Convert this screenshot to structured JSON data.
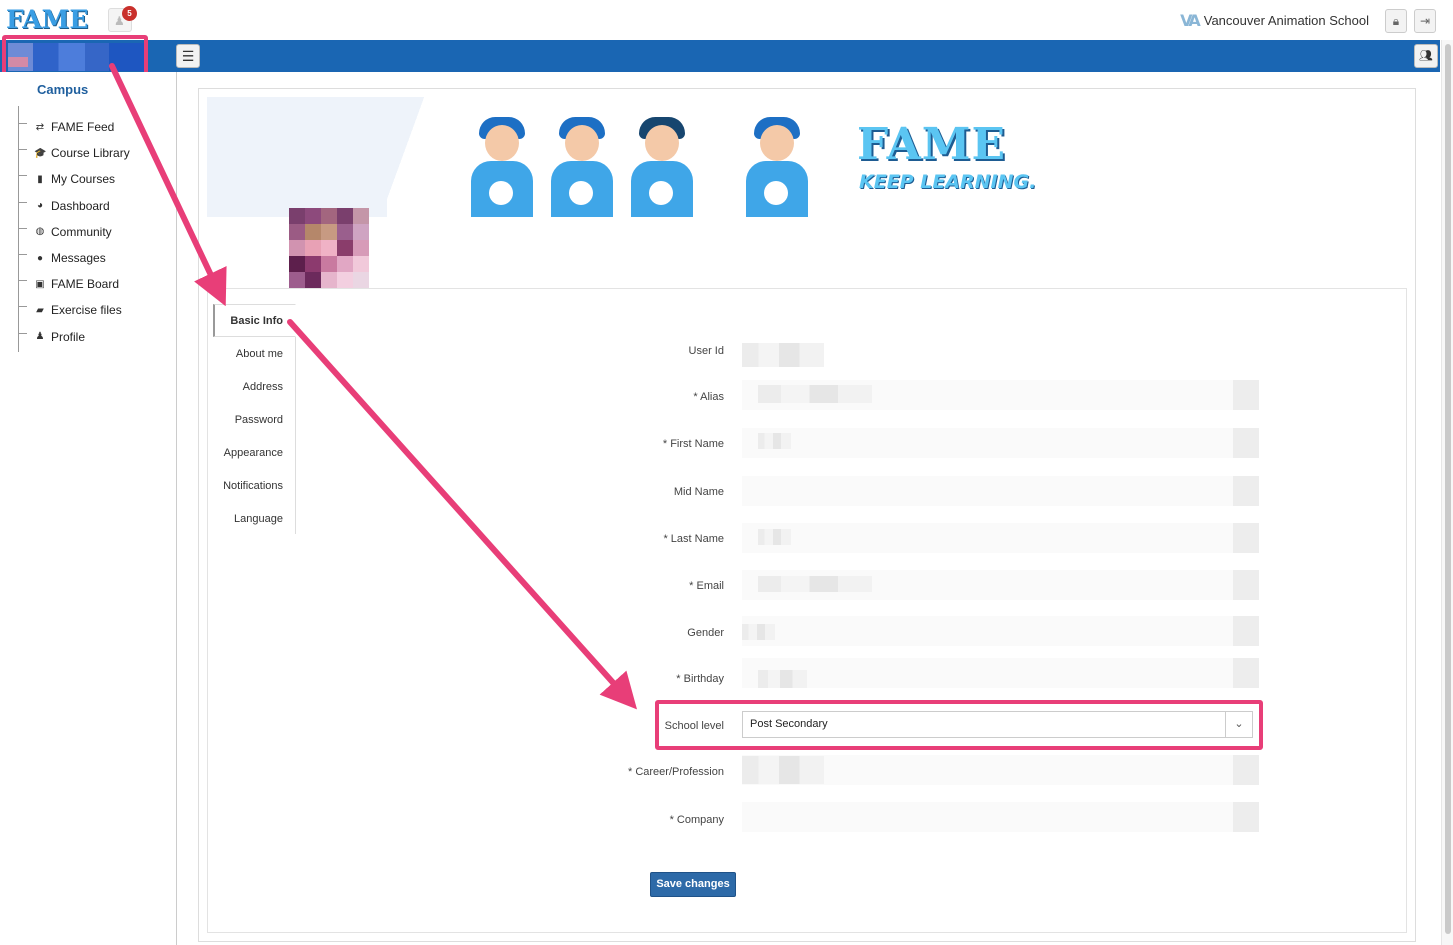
{
  "header": {
    "logo": "FAME",
    "notification_count": "5",
    "school_name": "Vancouver Animation School",
    "school_logo": "VA"
  },
  "sidebar": {
    "section_title": "Campus",
    "items": [
      {
        "label": "FAME Feed",
        "icon": "retweet-icon",
        "glyph": "⇄"
      },
      {
        "label": "Course Library",
        "icon": "graduation-cap-icon",
        "glyph": "🎓"
      },
      {
        "label": "My Courses",
        "icon": "book-icon",
        "glyph": "▮"
      },
      {
        "label": "Dashboard",
        "icon": "dashboard-icon",
        "glyph": "◕"
      },
      {
        "label": "Community",
        "icon": "globe-icon",
        "glyph": "◍"
      },
      {
        "label": "Messages",
        "icon": "comment-icon",
        "glyph": "●"
      },
      {
        "label": "FAME Board",
        "icon": "image-icon",
        "glyph": "▣"
      },
      {
        "label": "Exercise files",
        "icon": "folder-open-icon",
        "glyph": "▰"
      },
      {
        "label": "Profile",
        "icon": "user-icon",
        "glyph": "♟"
      }
    ]
  },
  "banner": {
    "title": "FAME",
    "tagline": "KEEP LEARNING."
  },
  "tabs": [
    {
      "label": "Basic Info",
      "active": true
    },
    {
      "label": "About me"
    },
    {
      "label": "Address"
    },
    {
      "label": "Password"
    },
    {
      "label": "Appearance"
    },
    {
      "label": "Notifications"
    },
    {
      "label": "Language"
    }
  ],
  "form": {
    "user_id_label": "User Id",
    "alias_label": "* Alias",
    "first_name_label": "* First Name",
    "mid_name_label": "Mid Name",
    "last_name_label": "* Last Name",
    "email_label": "* Email",
    "gender_label": "Gender",
    "birthday_label": "* Birthday",
    "school_level_label": "School level",
    "school_level_value": "Post Secondary",
    "career_label": "* Career/Profession",
    "company_label": "* Company",
    "save_label": "Save changes"
  },
  "colors": {
    "brand_blue": "#1a66b3",
    "highlight": "#e83e78",
    "button": "#2d6aa8"
  }
}
